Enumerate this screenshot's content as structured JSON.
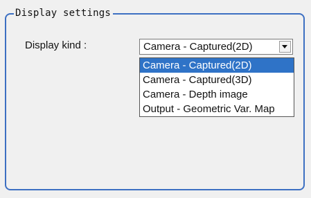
{
  "group": {
    "title": "Display settings"
  },
  "display_kind": {
    "label": "Display kind :",
    "selected_value": "Camera - Captured(2D)",
    "options": [
      "Camera - Captured(2D)",
      "Camera - Captured(3D)",
      "Camera - Depth image",
      "Output - Geometric Var. Map"
    ]
  },
  "colors": {
    "group_border": "#3c6fc2",
    "selection": "#2f73c7",
    "background": "#f0f0f0"
  }
}
